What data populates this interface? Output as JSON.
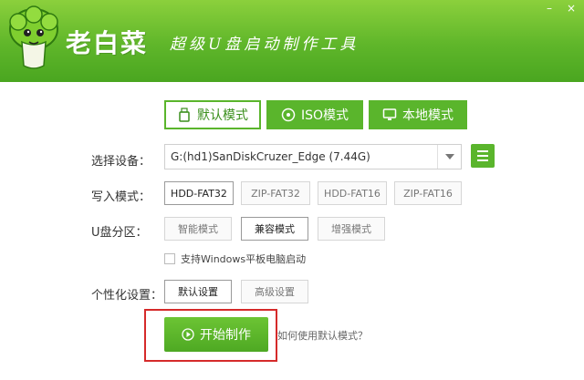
{
  "header": {
    "brand": "老白菜",
    "slogan": "超级U盘启动制作工具",
    "controls": [
      "–",
      "×"
    ]
  },
  "tabs": [
    {
      "label": "默认模式",
      "active": true
    },
    {
      "label": "ISO模式",
      "active": false
    },
    {
      "label": "本地模式",
      "active": false
    }
  ],
  "device": {
    "label": "选择设备：",
    "value": "G:(hd1)SanDiskCruzer_Edge (7.44G)"
  },
  "write_mode": {
    "label": "写入模式：",
    "options": [
      "HDD-FAT32",
      "ZIP-FAT32",
      "HDD-FAT16",
      "ZIP-FAT16"
    ],
    "selected": "HDD-FAT32"
  },
  "partition": {
    "label": "U盘分区：",
    "options": [
      "智能模式",
      "兼容模式",
      "增强模式"
    ],
    "selected": "兼容模式"
  },
  "tablet_boot": {
    "label": "支持Windows平板电脑启动",
    "checked": false
  },
  "personal": {
    "label": "个性化设置：",
    "options": [
      "默认设置",
      "高级设置"
    ],
    "selected": "默认设置"
  },
  "start": {
    "label": "开始制作",
    "help": "如何使用默认模式？"
  },
  "colors": {
    "accent": "#5ab52c",
    "highlight": "#d52a2a"
  }
}
